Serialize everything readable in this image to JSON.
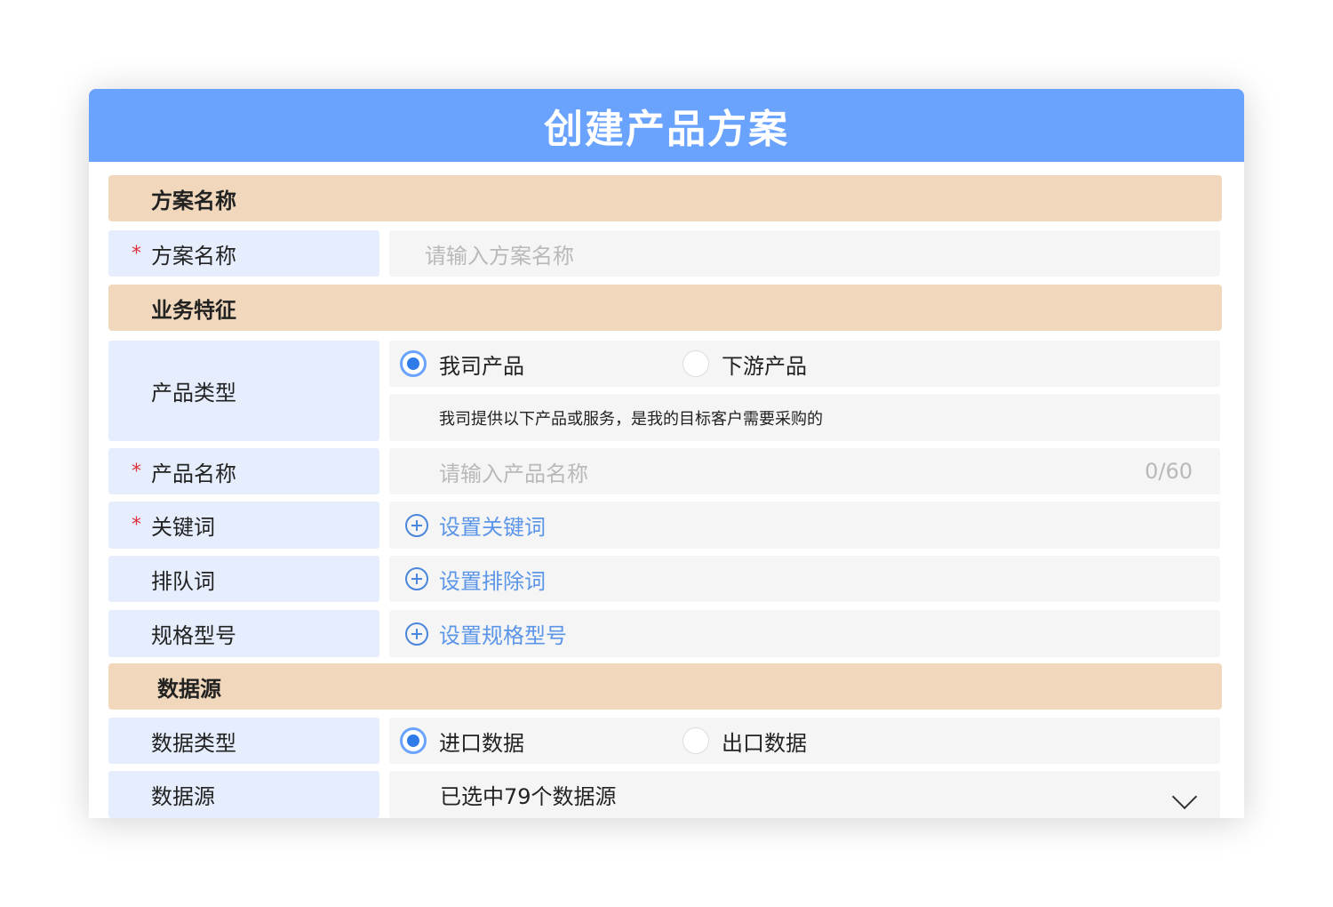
{
  "header": {
    "title": "创建产品方案"
  },
  "sections": {
    "plan_name": "方案名称",
    "business": "业务特征",
    "datasource": "数据源"
  },
  "fields": {
    "plan_name": {
      "label": "方案名称",
      "required": "*",
      "placeholder": "请输入方案名称"
    },
    "product_type": {
      "label": "产品类型",
      "options": [
        "我司产品",
        "下游产品"
      ],
      "selected": "我司产品",
      "hint": "我司提供以下产品或服务，是我的目标客户需要采购的"
    },
    "product_name": {
      "label": "产品名称",
      "required": "*",
      "placeholder": "请输入产品名称",
      "counter": "0/60"
    },
    "keywords": {
      "label": "关键词",
      "required": "*",
      "action": "设置关键词"
    },
    "exclude_words": {
      "label": "排队词",
      "action": "设置排除词"
    },
    "spec_model": {
      "label": "规格型号",
      "action": "设置规格型号"
    },
    "data_type": {
      "label": "数据类型",
      "options": [
        "进口数据",
        "出口数据"
      ],
      "selected": "进口数据"
    },
    "data_source": {
      "label": "数据源",
      "value": "已选中79个数据源"
    }
  },
  "colors": {
    "header": "#6aa3fd",
    "section": "#f1d8bc",
    "label_bg": "#e6eefe",
    "link": "#5b95e8",
    "required": "#e0303a"
  },
  "icons": [
    "radio-checked",
    "radio-unchecked",
    "plus-circle-icon",
    "chevron-down-icon"
  ]
}
